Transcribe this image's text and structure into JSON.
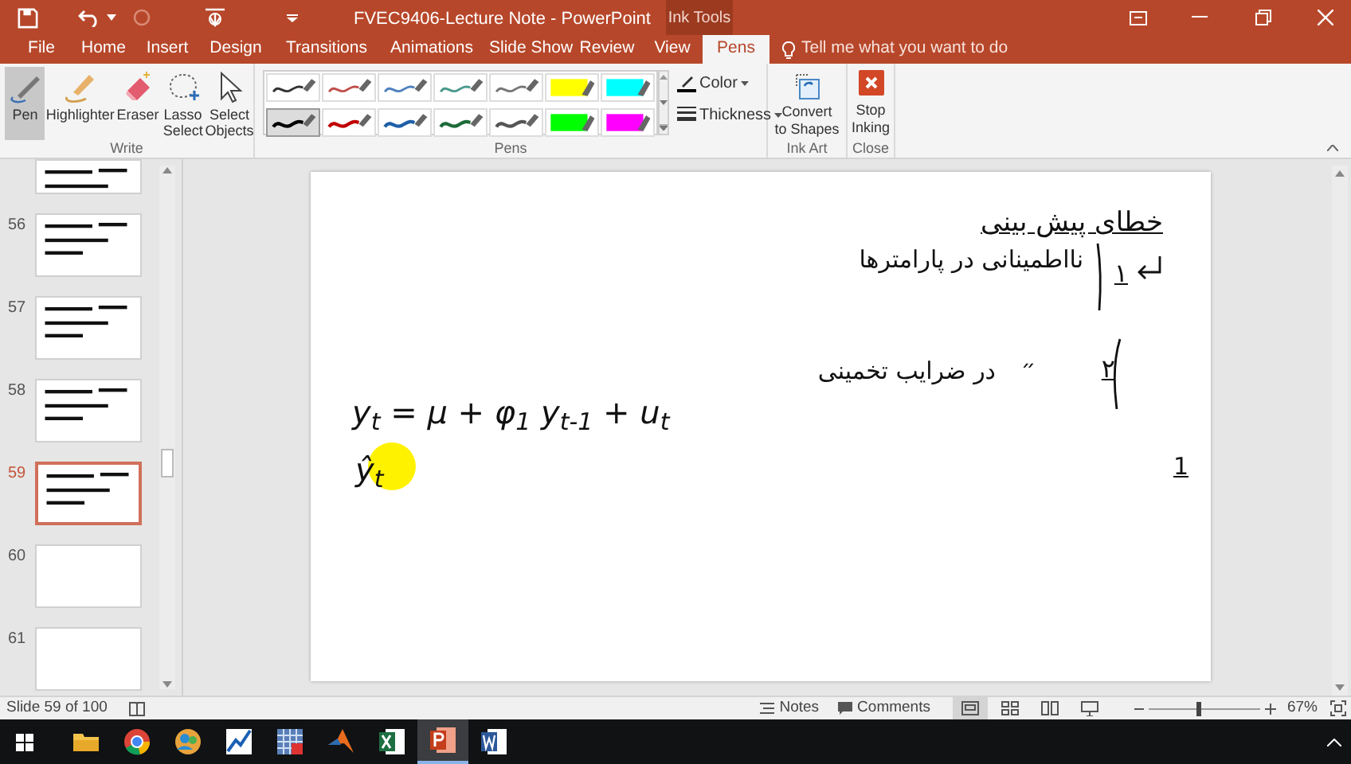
{
  "window": {
    "title": "FVEC9406-Lecture Note - PowerPoint",
    "context_label": "Ink Tools"
  },
  "tabs": [
    {
      "label": "File",
      "selected": false
    },
    {
      "label": "Home",
      "selected": false
    },
    {
      "label": "Insert",
      "selected": false
    },
    {
      "label": "Design",
      "selected": false
    },
    {
      "label": "Transitions",
      "selected": false
    },
    {
      "label": "Animations",
      "selected": false
    },
    {
      "label": "Slide Show",
      "selected": false
    },
    {
      "label": "Review",
      "selected": false
    },
    {
      "label": "View",
      "selected": false
    },
    {
      "label": "Pens",
      "selected": true
    }
  ],
  "tell_me": {
    "placeholder": "Tell me what you want to do"
  },
  "write_group": {
    "label": "Write",
    "tools": [
      {
        "kind": "pen",
        "label": "Pen",
        "selected": true
      },
      {
        "kind": "highlighter",
        "label": "Highlighter",
        "selected": false
      },
      {
        "kind": "eraser",
        "label": "Eraser",
        "selected": false
      },
      {
        "kind": "lasso",
        "label": "Lasso Select",
        "selected": false
      },
      {
        "kind": "pointer",
        "label": "Select Objects",
        "selected": false
      }
    ]
  },
  "pens_group": {
    "label": "Pens",
    "pens": [
      {
        "kind": "pen",
        "color": "#333333",
        "selected": false
      },
      {
        "kind": "pen",
        "color": "#c0504d",
        "selected": false
      },
      {
        "kind": "pen",
        "color": "#4f81bd",
        "selected": false
      },
      {
        "kind": "pen",
        "color": "#4a9a8c",
        "selected": false
      },
      {
        "kind": "pen",
        "color": "#777777",
        "selected": false
      },
      {
        "kind": "highlighter",
        "color": "#ffff00",
        "selected": false
      },
      {
        "kind": "highlighter",
        "color": "#00ffff",
        "selected": false
      },
      {
        "kind": "pen",
        "color": "#000000",
        "selected": true
      },
      {
        "kind": "pen",
        "color": "#c00000",
        "selected": false
      },
      {
        "kind": "pen",
        "color": "#1f5fa8",
        "selected": false
      },
      {
        "kind": "pen",
        "color": "#1e6b3a",
        "selected": false
      },
      {
        "kind": "pen",
        "color": "#555555",
        "selected": false
      },
      {
        "kind": "highlighter",
        "color": "#00ff00",
        "selected": false
      },
      {
        "kind": "highlighter",
        "color": "#ff00ff",
        "selected": false
      }
    ],
    "color_label": "Color",
    "thickness_label": "Thickness"
  },
  "ink_art_group": {
    "label": "Ink Art",
    "button": "Convert to Shapes"
  },
  "close_group": {
    "label": "Close",
    "button": "Stop Inking"
  },
  "thumbnails": [
    {
      "selected": false,
      "has_ink": true
    },
    {
      "number": "56",
      "selected": false,
      "has_ink": true
    },
    {
      "number": "57",
      "selected": false,
      "has_ink": true
    },
    {
      "number": "58",
      "selected": false,
      "has_ink": true
    },
    {
      "number": "59",
      "selected": true,
      "has_ink": true
    },
    {
      "number": "60",
      "selected": false,
      "has_ink": false
    },
    {
      "number": "61",
      "selected": false,
      "has_ink": false
    }
  ],
  "slide": {
    "ink": [
      {
        "kind": "heading",
        "text": "خطای پیش بینی"
      },
      {
        "kind": "number",
        "text": "۱"
      },
      {
        "kind": "line",
        "text": "نااطمینانی در پارامترها"
      },
      {
        "kind": "number",
        "text": "۲"
      },
      {
        "kind": "ditto",
        "text": "״"
      },
      {
        "kind": "line",
        "text": "در ضرایب تخمینی"
      },
      {
        "kind": "equation",
        "text": "y$_{t}$ = μ + φ$_{1}$ y$_{t-1}$ + u$_{t}$"
      },
      {
        "kind": "estimate",
        "text": "ŷ$_{t}$",
        "highlighted": true
      },
      {
        "kind": "number",
        "text": "1"
      }
    ]
  },
  "status_bar": {
    "slide_info": "Slide 59 of 100",
    "notes": "Notes",
    "comments": "Comments",
    "views": [
      {
        "kind": "normal",
        "selected": true
      },
      {
        "kind": "sorter",
        "selected": false
      },
      {
        "kind": "reading",
        "selected": false
      },
      {
        "kind": "show",
        "selected": false
      }
    ],
    "zoom": {
      "level": 0.45
    },
    "zoom_reading": "67%"
  },
  "taskbar": {
    "apps": [
      {
        "kind": "explorer",
        "selected": false
      },
      {
        "kind": "chrome",
        "selected": false
      },
      {
        "kind": "people",
        "selected": false
      },
      {
        "kind": "chart",
        "selected": false
      },
      {
        "kind": "grid",
        "selected": false
      },
      {
        "kind": "matlab",
        "selected": false
      },
      {
        "kind": "excel",
        "selected": false
      },
      {
        "kind": "powerpoint",
        "selected": true
      },
      {
        "kind": "word",
        "selected": false
      }
    ]
  }
}
